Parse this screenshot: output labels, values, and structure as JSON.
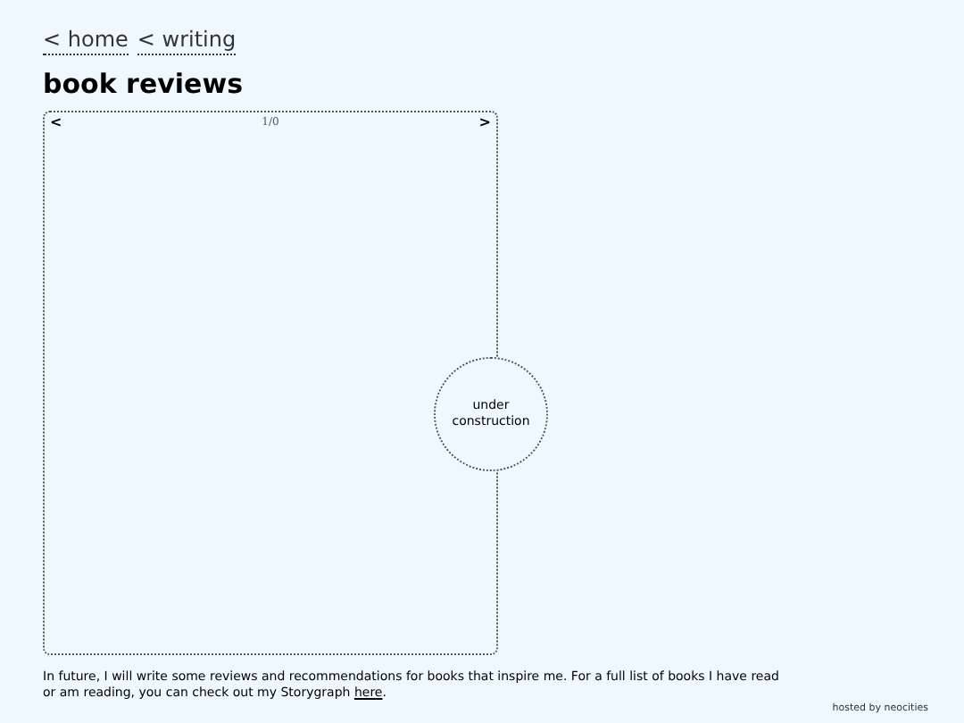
{
  "breadcrumbs": [
    {
      "label": "< home"
    },
    {
      "label": "< writing"
    }
  ],
  "title": "book reviews",
  "viewer": {
    "prev": "<",
    "counter": "1/0",
    "next": ">"
  },
  "badge": {
    "label": "under construction"
  },
  "intro": {
    "text_before": "In future, I will write some reviews and recommendations for books that inspire me. For a full list of books I have read or am reading, you can check out my Storygraph ",
    "link": "here",
    "text_after": "."
  },
  "footer": "hosted by neocities"
}
